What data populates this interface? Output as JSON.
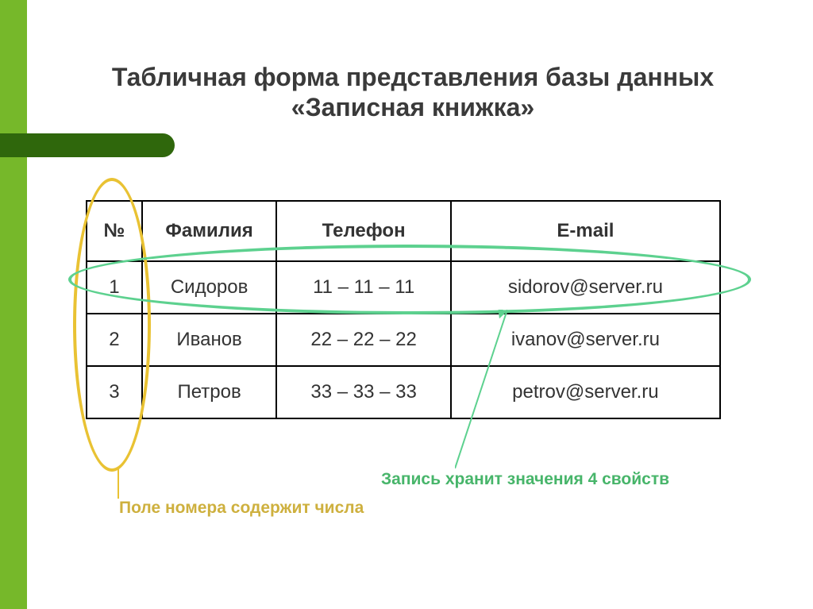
{
  "title": "Табличная форма представления базы данных «Записная книжка»",
  "headers": {
    "num": "№",
    "surname": "Фамилия",
    "phone": "Телефон",
    "email": "E-mail"
  },
  "rows": [
    {
      "num": "1",
      "surname": "Сидоров",
      "phone": "11 – 11 – 11",
      "email": "sidorov@server.ru"
    },
    {
      "num": "2",
      "surname": "Иванов",
      "phone": "22 – 22 – 22",
      "email": "ivanov@server.ru"
    },
    {
      "num": "3",
      "surname": "Петров",
      "phone": "33 – 33 – 33",
      "email": "petrov@server.ru"
    }
  ],
  "callouts": {
    "column": "Поле номера содержит числа",
    "row": "Запись хранит значения 4 свойств"
  }
}
